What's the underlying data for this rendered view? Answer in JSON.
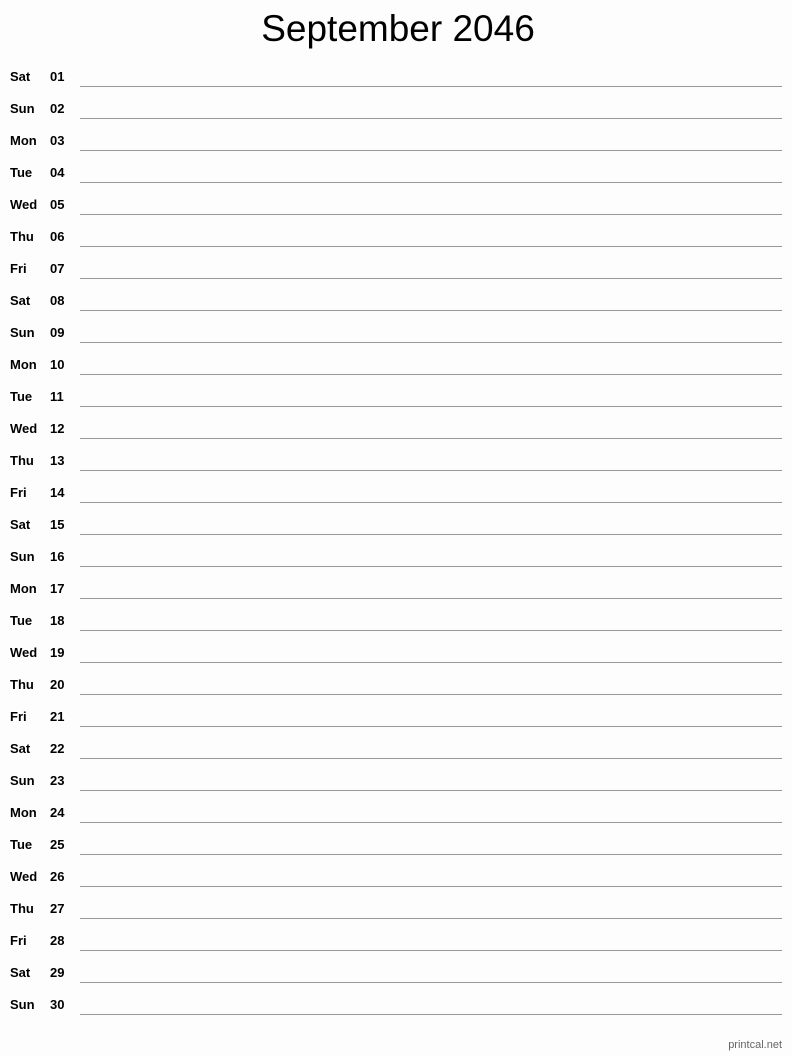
{
  "header": {
    "title": "September 2046"
  },
  "days": [
    {
      "dow": "Sat",
      "day": "01"
    },
    {
      "dow": "Sun",
      "day": "02"
    },
    {
      "dow": "Mon",
      "day": "03"
    },
    {
      "dow": "Tue",
      "day": "04"
    },
    {
      "dow": "Wed",
      "day": "05"
    },
    {
      "dow": "Thu",
      "day": "06"
    },
    {
      "dow": "Fri",
      "day": "07"
    },
    {
      "dow": "Sat",
      "day": "08"
    },
    {
      "dow": "Sun",
      "day": "09"
    },
    {
      "dow": "Mon",
      "day": "10"
    },
    {
      "dow": "Tue",
      "day": "11"
    },
    {
      "dow": "Wed",
      "day": "12"
    },
    {
      "dow": "Thu",
      "day": "13"
    },
    {
      "dow": "Fri",
      "day": "14"
    },
    {
      "dow": "Sat",
      "day": "15"
    },
    {
      "dow": "Sun",
      "day": "16"
    },
    {
      "dow": "Mon",
      "day": "17"
    },
    {
      "dow": "Tue",
      "day": "18"
    },
    {
      "dow": "Wed",
      "day": "19"
    },
    {
      "dow": "Thu",
      "day": "20"
    },
    {
      "dow": "Fri",
      "day": "21"
    },
    {
      "dow": "Sat",
      "day": "22"
    },
    {
      "dow": "Sun",
      "day": "23"
    },
    {
      "dow": "Mon",
      "day": "24"
    },
    {
      "dow": "Tue",
      "day": "25"
    },
    {
      "dow": "Wed",
      "day": "26"
    },
    {
      "dow": "Thu",
      "day": "27"
    },
    {
      "dow": "Fri",
      "day": "28"
    },
    {
      "dow": "Sat",
      "day": "29"
    },
    {
      "dow": "Sun",
      "day": "30"
    }
  ],
  "footer": {
    "credit": "printcal.net"
  }
}
